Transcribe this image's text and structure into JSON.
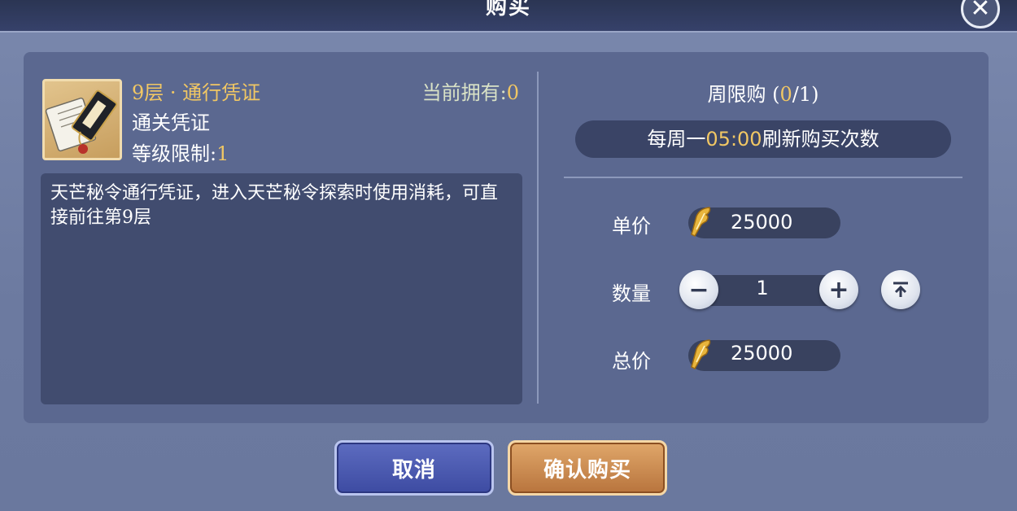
{
  "dialog": {
    "title": "购买",
    "close_icon": "close-icon"
  },
  "item": {
    "name": "9层 · 通行凭证",
    "type": "通关凭证",
    "level_label": "等级限制:",
    "level_value": "1",
    "owned_label": "当前拥有:",
    "owned_value": "0",
    "description": "天芒秘令通行凭证，进入天芒秘令探索时使用消耗，可直接前往第9层",
    "icon": "pass-scroll-icon"
  },
  "limit": {
    "title_prefix": "周限购 (",
    "current": "0",
    "title_suffix": "/1)",
    "refresh_prefix": "每周一",
    "refresh_time": "05:00",
    "refresh_suffix": "刷新购买次数"
  },
  "purchase": {
    "unit_price_label": "单价",
    "unit_price": "25000",
    "quantity_label": "数量",
    "quantity": "1",
    "total_label": "总价",
    "total_price": "25000",
    "currency_icon": "gold-feather-icon"
  },
  "buttons": {
    "cancel": "取消",
    "confirm": "确认购买"
  },
  "colors": {
    "accent_gold": "#f1c764",
    "panel_bg": "#5b6890",
    "cancel_blue": "#4b58b0",
    "confirm_orange": "#c98a4e"
  }
}
